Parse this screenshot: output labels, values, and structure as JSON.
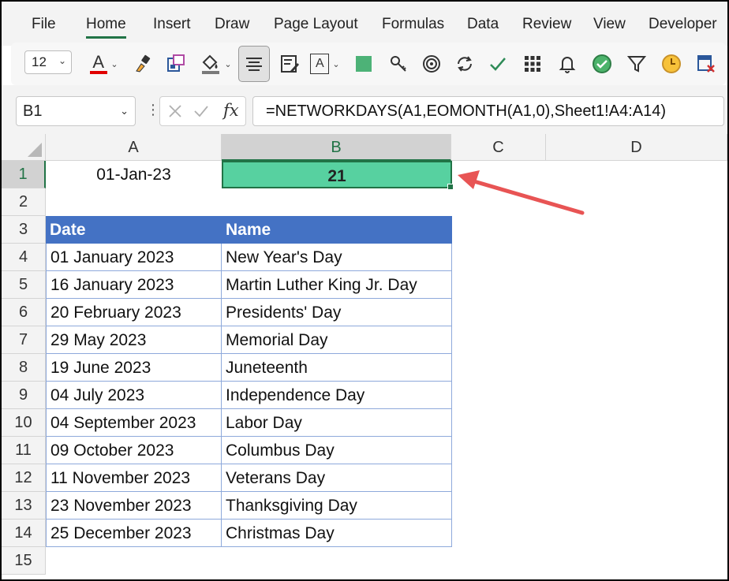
{
  "menu": {
    "items": [
      "File",
      "Home",
      "Insert",
      "Draw",
      "Page Layout",
      "Formulas",
      "Data",
      "Review",
      "View",
      "Developer"
    ],
    "active_index": 1
  },
  "ribbon": {
    "font_size": "12",
    "font_color_letter": "A",
    "text_box_letter": "A",
    "accent_color": "#217346",
    "icons": [
      "font-color-icon",
      "format-painter-icon",
      "object-icon",
      "fill-color-icon",
      "align-center-icon",
      "form-icon",
      "text-box-icon",
      "green-fill-icon",
      "key-icon",
      "target-icon",
      "refresh-icon",
      "check-icon",
      "grid-icon",
      "bell-icon",
      "green-check-circle-icon",
      "filter-icon",
      "clock-icon",
      "remove-table-icon"
    ]
  },
  "formula_bar": {
    "name_box": "B1",
    "fx_label": "fx",
    "formula": "=NETWORKDAYS(A1,EOMONTH(A1,0),Sheet1!A4:A14)"
  },
  "grid": {
    "columns": [
      "A",
      "B",
      "C",
      "D"
    ],
    "selected_column": "B",
    "rows": [
      "1",
      "2",
      "3",
      "4",
      "5",
      "6",
      "7",
      "8",
      "9",
      "10",
      "11",
      "12",
      "13",
      "14",
      "15"
    ],
    "selected_row": "1",
    "a1": "01-Jan-23",
    "b1": "21",
    "result_fill": "#57d1a0",
    "table_header_color": "#4472c4",
    "table": {
      "headers": [
        "Date",
        "Name"
      ],
      "rows": [
        [
          "01 January 2023",
          "New Year's Day"
        ],
        [
          "16 January 2023",
          "Martin Luther King Jr. Day"
        ],
        [
          "20 February 2023",
          "Presidents' Day"
        ],
        [
          "29 May 2023",
          "Memorial Day"
        ],
        [
          "19 June 2023",
          "Juneteenth"
        ],
        [
          "04 July 2023",
          "Independence Day"
        ],
        [
          "04 September 2023",
          "Labor Day"
        ],
        [
          "09 October 2023",
          "Columbus Day"
        ],
        [
          "11 November 2023",
          "Veterans Day"
        ],
        [
          "23 November 2023",
          "Thanksgiving Day"
        ],
        [
          "25 December 2023",
          "Christmas Day"
        ]
      ]
    },
    "annotation_arrow_color": "#e85454"
  }
}
